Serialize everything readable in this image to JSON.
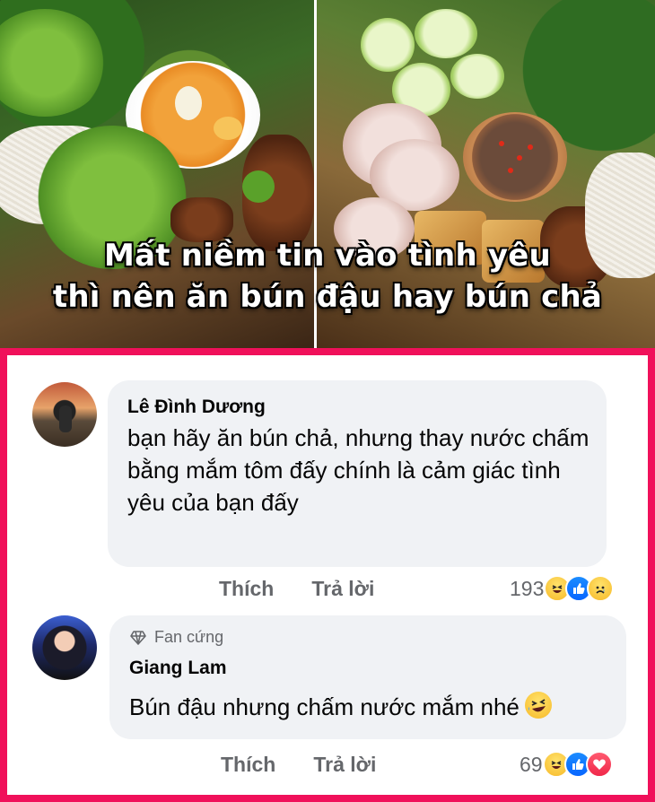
{
  "banner": {
    "title_line1": "Mất niềm tin vào tình yêu",
    "title_line2": "thì nên ăn bún đậu hay bún chả"
  },
  "comments": [
    {
      "author": "Lê Đình Dương",
      "text": "bạn hãy ăn bún chả, nhưng thay nước chấm bằng mắm tôm đấy chính là cảm giác tình yêu của bạn đấy",
      "like_label": "Thích",
      "reply_label": "Trả lời",
      "reaction_count": "193",
      "reactions": [
        "haha",
        "like",
        "sad"
      ]
    },
    {
      "badge": "Fan cứng",
      "author": "Giang Lam",
      "text": "Bún đậu nhưng chấm nước mắm nhé",
      "like_label": "Thích",
      "reply_label": "Trả lời",
      "reaction_count": "69",
      "reactions": [
        "haha",
        "like",
        "love"
      ]
    }
  ],
  "colors": {
    "frame": "#f0105a",
    "bubble": "#f0f2f5",
    "muted_text": "#65676b"
  }
}
